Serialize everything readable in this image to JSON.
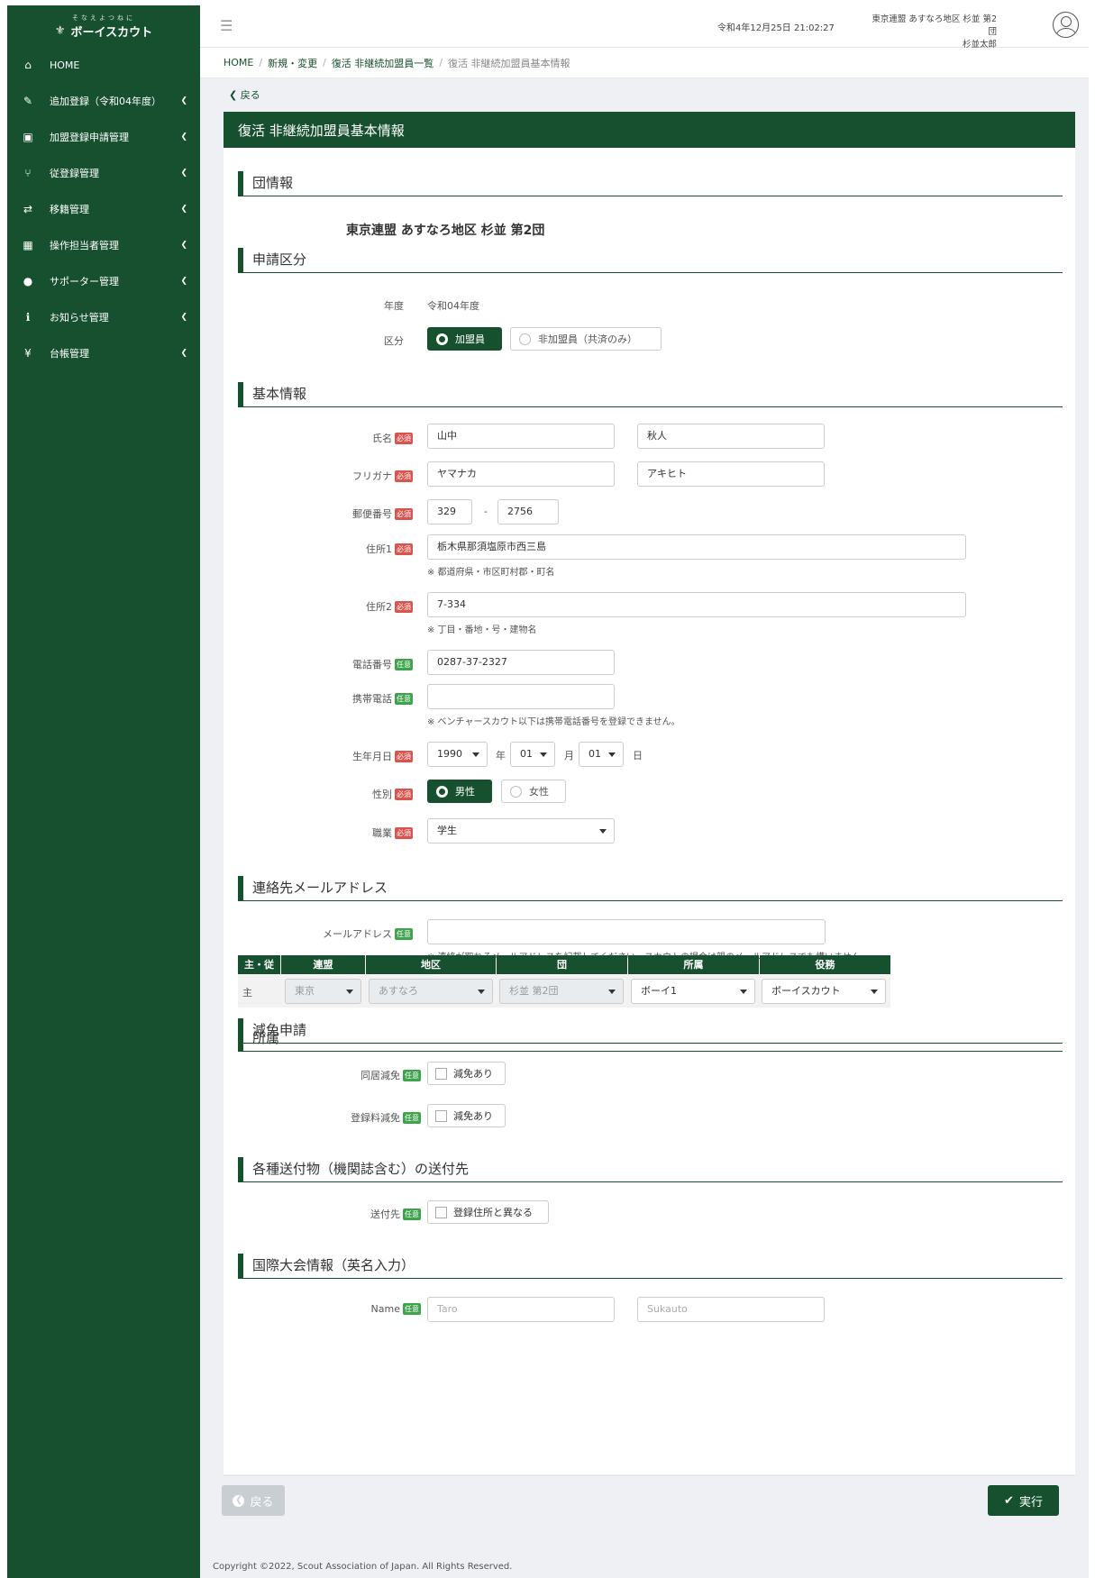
{
  "app": {
    "logo_sub": "そなえよつねに",
    "logo_main": "ボーイスカウト",
    "datetime": "令和4年12月25日 21:02:27",
    "user_org": "東京連盟 あすなろ地区 杉並 第2団",
    "user_name": "杉並太郎"
  },
  "sidebar": {
    "items": [
      {
        "label": "HOME",
        "icon": "home-icon"
      },
      {
        "label": "追加登録（令和04年度）",
        "icon": "edit-icon"
      },
      {
        "label": "加盟登録申請管理",
        "icon": "id-card-icon"
      },
      {
        "label": "従登録管理",
        "icon": "branch-icon"
      },
      {
        "label": "移籍管理",
        "icon": "transfer-icon"
      },
      {
        "label": "操作担当者管理",
        "icon": "operator-icon"
      },
      {
        "label": "サポーター管理",
        "icon": "supporter-icon"
      },
      {
        "label": "お知らせ管理",
        "icon": "info-icon"
      },
      {
        "label": "台帳管理",
        "icon": "yen-icon"
      }
    ]
  },
  "breadcrumb": [
    "HOME",
    "新規・変更",
    "復活 非継続加盟員一覧",
    "復活 非継続加盟員基本情報"
  ],
  "back_link": "戻る",
  "page_title": "復活 非継続加盟員基本情報",
  "badges": {
    "required": "必須",
    "optional": "任意"
  },
  "sections": {
    "group": "団情報",
    "apply": "申請区分",
    "basic": "基本情報",
    "email": "連絡先メールアドレス",
    "affil": "所属",
    "reduce": "減免申請",
    "ship": "各種送付物（機関誌含む）の送付先",
    "intl": "国際大会情報（英名入力）"
  },
  "group_name": "東京連盟 あすなろ地区 杉並 第2団",
  "apply": {
    "year_label": "年度",
    "year_value": "令和04年度",
    "kubun_label": "区分",
    "kubun_options": [
      "加盟員",
      "非加盟員（共済のみ）"
    ]
  },
  "basic": {
    "name_label": "氏名",
    "last_name": "山中",
    "first_name": "秋人",
    "kana_label": "フリガナ",
    "last_kana": "ヤマナカ",
    "first_kana": "アキヒト",
    "zip_label": "郵便番号",
    "zip1": "329",
    "zip_dash": "-",
    "zip2": "2756",
    "addr1_label": "住所1",
    "addr1": "栃木県那須塩原市西三島",
    "addr1_note": "※ 都道府県・市区町村郡・町名",
    "addr2_label": "住所2",
    "addr2": "7-334",
    "addr2_note": "※ 丁目・番地・号・建物名",
    "tel_label": "電話番号",
    "tel": "0287-37-2327",
    "mobile_label": "携帯電話",
    "mobile": "",
    "mobile_note": "※ ベンチャースカウト以下は携帯電話番号を登録できません。",
    "birth_label": "生年月日",
    "birth_year": "1990",
    "year_unit": "年",
    "birth_month": "01",
    "month_unit": "月",
    "birth_day": "01",
    "day_unit": "日",
    "gender_label": "性別",
    "gender_options": [
      "男性",
      "女性"
    ],
    "job_label": "職業",
    "job": "学生"
  },
  "email": {
    "label": "メールアドレス",
    "value": "",
    "note": "※ 連絡が取れるメールアドレスを記載してください。スカウトの場合は親のメールアドレスでも構いません。"
  },
  "affil": {
    "headers": [
      "主・従",
      "連盟",
      "地区",
      "団",
      "所属",
      "役務"
    ],
    "row": {
      "type": "主",
      "federation": "東京",
      "district": "あすなろ",
      "group": "杉並 第2団",
      "unit": "ボーイ1",
      "role": "ボーイスカウト"
    }
  },
  "reduce": {
    "cohab_label": "同居減免",
    "cohab_check": "減免あり",
    "fee_label": "登録料減免",
    "fee_check": "減免あり"
  },
  "ship": {
    "label": "送付先",
    "check": "登録住所と異なる"
  },
  "intl": {
    "label": "Name",
    "first_placeholder": "Taro",
    "last_placeholder": "Sukauto"
  },
  "buttons": {
    "back": "戻る",
    "execute": "実行"
  },
  "footer": "Copyright ©2022, Scout Association of Japan. All Rights Reserved."
}
